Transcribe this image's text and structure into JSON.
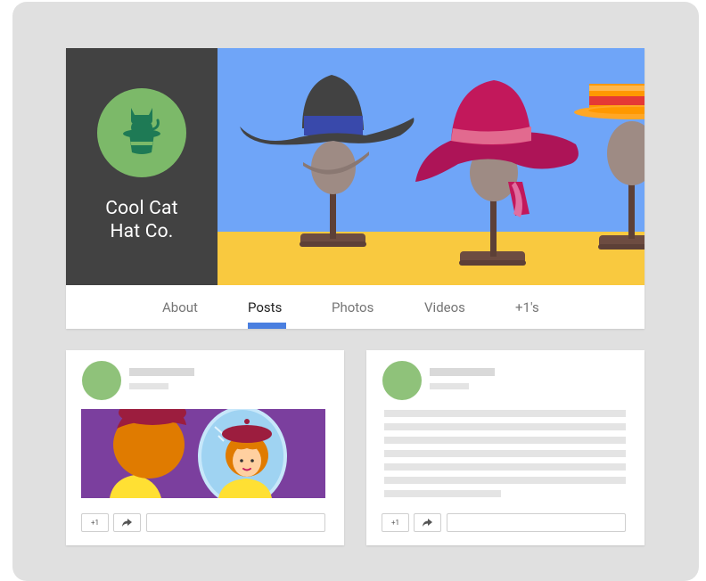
{
  "brand": {
    "name_line1": "Cool Cat",
    "name_line2": "Hat Co.",
    "logo_icon": "cat-in-top-hat-icon"
  },
  "cover": {
    "image": "hats-on-mannequin-heads",
    "hats": [
      "bowler-hat",
      "wide-brim-sun-hat",
      "straw-boater-hat"
    ]
  },
  "tabs": [
    {
      "label": "About",
      "active": false
    },
    {
      "label": "Posts",
      "active": true
    },
    {
      "label": "Photos",
      "active": false
    },
    {
      "label": "Videos",
      "active": false
    },
    {
      "label": "+1's",
      "active": false
    }
  ],
  "posts": [
    {
      "has_image": true,
      "image": "woman-in-beret-mirror",
      "plus_one_label": "+1",
      "share_icon": "share-arrow-icon"
    },
    {
      "has_image": false,
      "plus_one_label": "+1",
      "share_icon": "share-arrow-icon"
    }
  ],
  "colors": {
    "brand_panel": "#424242",
    "logo_circle": "#7cb969",
    "cover_sky": "#6fa5f8",
    "cover_floor": "#f9c93f",
    "active_tab": "#4a7fe0",
    "avatar": "#8fc27a",
    "frame": "#e0e0e0"
  }
}
